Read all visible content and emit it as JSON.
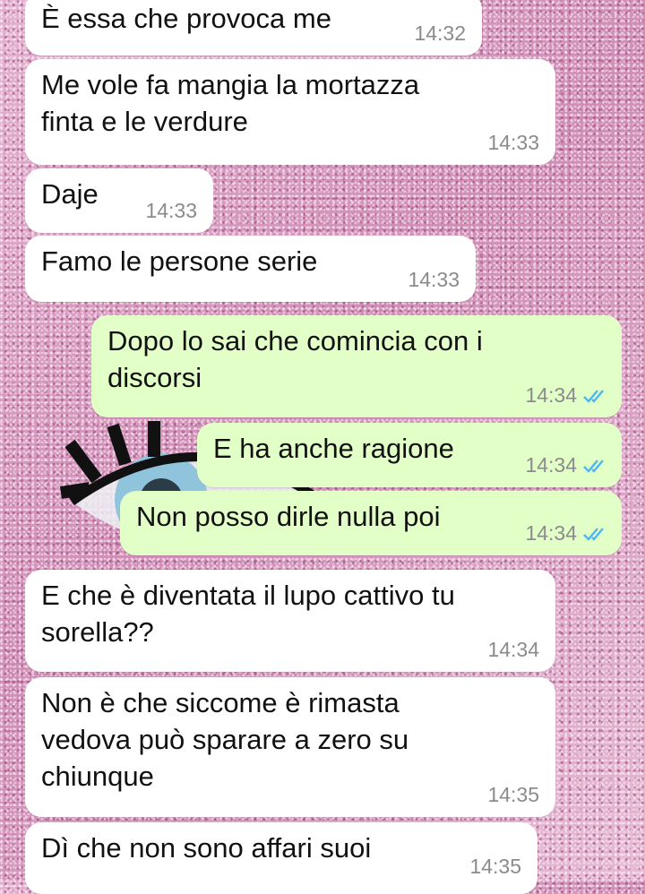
{
  "chat": {
    "messages": [
      {
        "direction": "incoming",
        "text_lines": [
          "È essa che provoca me"
        ],
        "time": "14:32"
      },
      {
        "direction": "incoming",
        "text_lines": [
          "Me vole fa mangia la mortazza",
          "finta e le verdure"
        ],
        "time": "14:33"
      },
      {
        "direction": "incoming",
        "text_lines": [
          "Daje"
        ],
        "time": "14:33"
      },
      {
        "direction": "incoming",
        "text_lines": [
          "Famo le persone serie"
        ],
        "time": "14:33"
      },
      {
        "direction": "outgoing",
        "text_lines": [
          "Dopo lo sai che comincia con i",
          "discorsi"
        ],
        "time": "14:34",
        "status_icon": "double-check-read-icon"
      },
      {
        "direction": "outgoing",
        "text_lines": [
          "E ha anche ragione"
        ],
        "time": "14:34",
        "status_icon": "double-check-read-icon"
      },
      {
        "direction": "outgoing",
        "text_lines": [
          "Non posso dirle nulla poi"
        ],
        "time": "14:34",
        "status_icon": "double-check-read-icon"
      },
      {
        "direction": "incoming",
        "text_lines": [
          "E che è diventata il lupo cattivo tu",
          "sorella??"
        ],
        "time": "14:34"
      },
      {
        "direction": "incoming",
        "text_lines": [
          "Non è che siccome è rimasta",
          "vedova può sparare a zero su",
          "chiunque"
        ],
        "time": "14:35"
      },
      {
        "direction": "incoming",
        "text_lines": [
          "Dì che non sono affari suoi"
        ],
        "time": "14:35"
      }
    ]
  },
  "colors": {
    "incoming_bubble": "#ffffff",
    "outgoing_bubble": "#e2ffc7",
    "timestamp": "#8b8b8b",
    "read_checks": "#4fb6ec",
    "wallpaper": "#d9a2c2"
  }
}
